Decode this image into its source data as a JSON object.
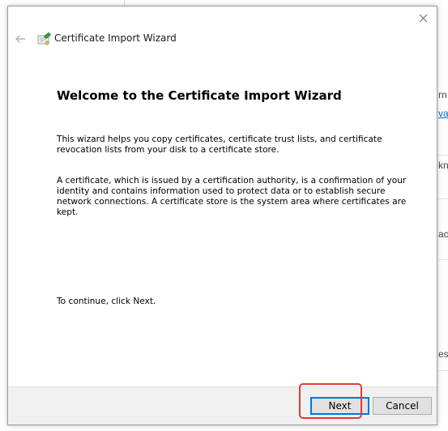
{
  "background_app": {
    "fragments": [
      "rn",
      "va",
      "kn",
      "ac",
      "es"
    ]
  },
  "dialog": {
    "title": "Certificate Import Wizard",
    "heading": "Welcome to the Certificate Import Wizard",
    "paragraph1": "This wizard helps you copy certificates, certificate trust lists, and certificate revocation lists from your disk to a certificate store.",
    "paragraph2": "A certificate, which is issued by a certification authority, is a confirmation of your identity and contains information used to protect data or to establish secure network connections. A certificate store is the system area where certificates are kept.",
    "paragraph3": "To continue, click Next."
  },
  "buttons": {
    "next_label": "Next",
    "cancel_label": "Cancel"
  },
  "icons": {
    "close": "close-icon",
    "back": "back-arrow-icon",
    "certificate": "certificate-icon"
  },
  "colors": {
    "default_button_border": "#0078d7",
    "annotation_highlight": "#e53935",
    "link": "#0a64c8"
  }
}
